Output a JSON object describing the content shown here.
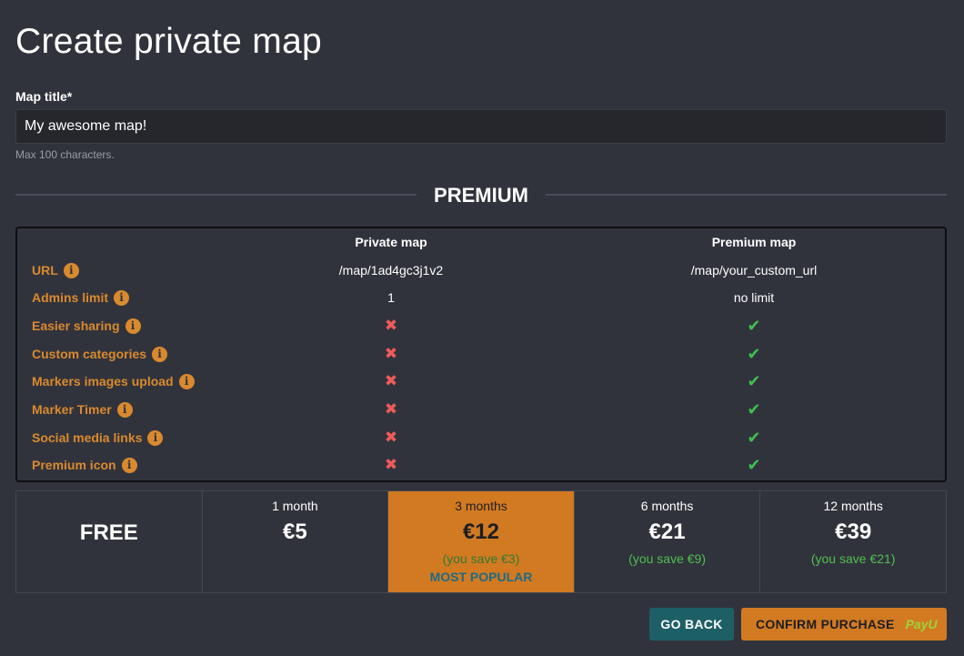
{
  "page": {
    "title": "Create private map"
  },
  "form": {
    "title_label": "Map title*",
    "title_value": "My awesome map!",
    "title_help": "Max 100 characters."
  },
  "section": {
    "title": "PREMIUM"
  },
  "comparison": {
    "col_private": "Private map",
    "col_premium": "Premium map",
    "rows": [
      {
        "name": "URL",
        "private": "/map/1ad4gc3j1v2",
        "premium": "/map/your_custom_url"
      },
      {
        "name": "Admins limit",
        "private": "1",
        "premium": "no limit"
      },
      {
        "name": "Easier sharing",
        "private": "✖",
        "premium": "✔"
      },
      {
        "name": "Custom categories",
        "private": "✖",
        "premium": "✔"
      },
      {
        "name": "Markers images upload",
        "private": "✖",
        "premium": "✔"
      },
      {
        "name": "Marker Timer",
        "private": "✖",
        "premium": "✔"
      },
      {
        "name": "Social media links",
        "private": "✖",
        "premium": "✔"
      },
      {
        "name": "Premium icon",
        "private": "✖",
        "premium": "✔"
      }
    ],
    "info_icon": "i"
  },
  "plans": {
    "free_label": "FREE",
    "items": [
      {
        "period": "1 month",
        "price": "€5",
        "save": "",
        "popular": ""
      },
      {
        "period": "3 months",
        "price": "€12",
        "save": "(you save €3)",
        "popular": "MOST POPULAR"
      },
      {
        "period": "6 months",
        "price": "€21",
        "save": "(you save €9)",
        "popular": ""
      },
      {
        "period": "12 months",
        "price": "€39",
        "save": "(you save €21)",
        "popular": ""
      }
    ]
  },
  "actions": {
    "back_label": "GO BACK",
    "confirm_label": "CONFIRM PURCHASE",
    "payu_logo": "PayU"
  },
  "colors": {
    "background": "#31333c",
    "accent_orange": "#d27a22",
    "feature_orange": "#d98a2e",
    "teal_button": "#1e5f66",
    "cross_red": "#ef5b5b",
    "check_green": "#3fbf4f"
  }
}
